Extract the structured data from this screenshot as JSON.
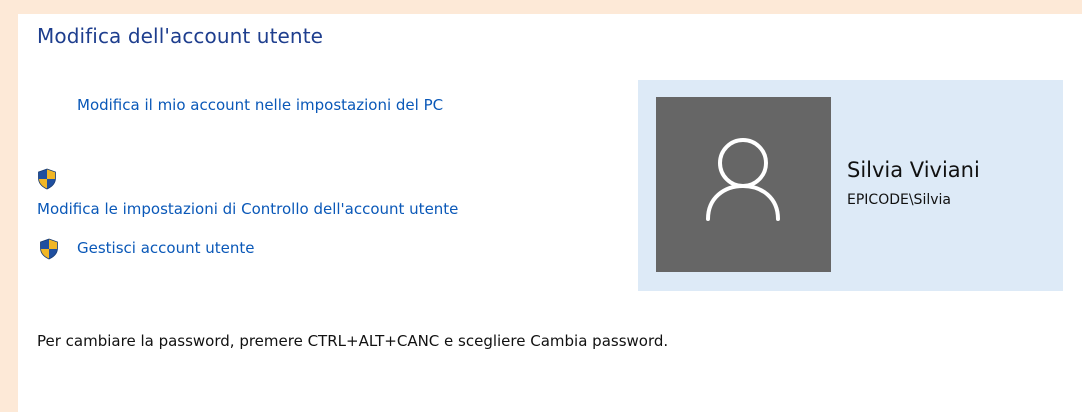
{
  "section": {
    "title": "Modifica dell'account utente"
  },
  "links": {
    "change_account_pc": "Modifica il mio account nelle impostazioni del PC",
    "uac_settings": "Modifica le impostazioni di Controllo dell'account utente",
    "manage_accounts": "Gestisci account utente"
  },
  "user": {
    "name": "Silvia Viviani",
    "account": "EPICODE\\Silvia"
  },
  "note": "Per cambiare la password, premere CTRL+ALT+CANC e scegliere Cambia password.",
  "colors": {
    "window_border": "#fde9d7",
    "title": "#1e3e8e",
    "link": "#0a58b8",
    "card_background": "#ddeaf7",
    "avatar_background": "#666666"
  },
  "icons": {
    "uac_shield": "uac-shield-icon",
    "avatar": "user-silhouette-icon"
  }
}
